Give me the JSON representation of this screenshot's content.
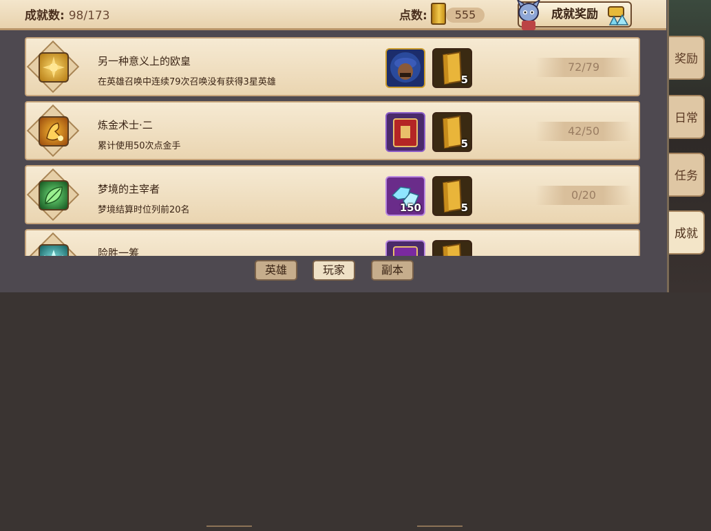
{
  "header": {
    "achievements_label": "成就数:",
    "achievements_value": "98/173",
    "points_label": "点数:",
    "points_value": "555",
    "reward_button_label": "成就奖励"
  },
  "achievements": [
    {
      "title": "另一种意义上的欧皇",
      "description": "在英雄召唤中连续79次召唤没有获得3星英雄",
      "icon": "golden-flower-icon",
      "rewards": [
        {
          "icon": "hero-portrait-icon",
          "count": ""
        },
        {
          "icon": "gold-book-icon",
          "count": "5"
        }
      ],
      "progress": "72/79"
    },
    {
      "title": "炼金术士·二",
      "description": "累计使用50次点金手",
      "icon": "golden-hand-icon",
      "rewards": [
        {
          "icon": "red-card-icon",
          "count": ""
        },
        {
          "icon": "gold-book-icon",
          "count": "5"
        }
      ],
      "progress": "42/50"
    },
    {
      "title": "梦境的主宰者",
      "description": "梦境结算时位列前20名",
      "icon": "green-leaf-icon",
      "rewards": [
        {
          "icon": "diamond-icon",
          "count": "150"
        },
        {
          "icon": "gold-book-icon",
          "count": "5"
        }
      ],
      "progress": "0/20"
    },
    {
      "title": "险胜一筹",
      "description": "",
      "icon": "teal-flower-icon",
      "rewards": [
        {
          "icon": "purple-card-icon",
          "count": ""
        },
        {
          "icon": "gold-book-icon",
          "count": ""
        }
      ],
      "progress": ""
    }
  ],
  "side_tabs": [
    {
      "label": "奖励",
      "active": false
    },
    {
      "label": "日常",
      "active": false
    },
    {
      "label": "任务",
      "active": false
    },
    {
      "label": "成就",
      "active": true
    }
  ],
  "bottom_tabs": [
    {
      "label": "英雄",
      "active": false
    },
    {
      "label": "玩家",
      "active": true
    },
    {
      "label": "副本",
      "active": false
    }
  ],
  "colors": {
    "panel": "#4e4950",
    "card": "#f2e2c4",
    "accent": "#d4a52a"
  }
}
